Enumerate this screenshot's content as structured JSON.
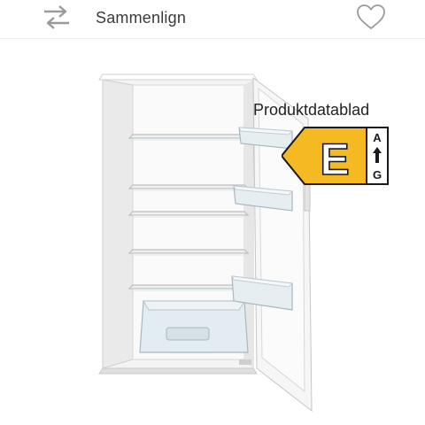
{
  "header": {
    "compare_label": "Sammenlign",
    "compare_icon": "compare-arrows-icon",
    "favorite_icon": "heart-outline-icon"
  },
  "product": {
    "image_subject": "white single-door refrigerator with open door",
    "datasheet_link": "Produktdatablad",
    "energy": {
      "class": "E",
      "scale_top": "A",
      "scale_bottom": "G",
      "color": "#F5B921"
    }
  }
}
